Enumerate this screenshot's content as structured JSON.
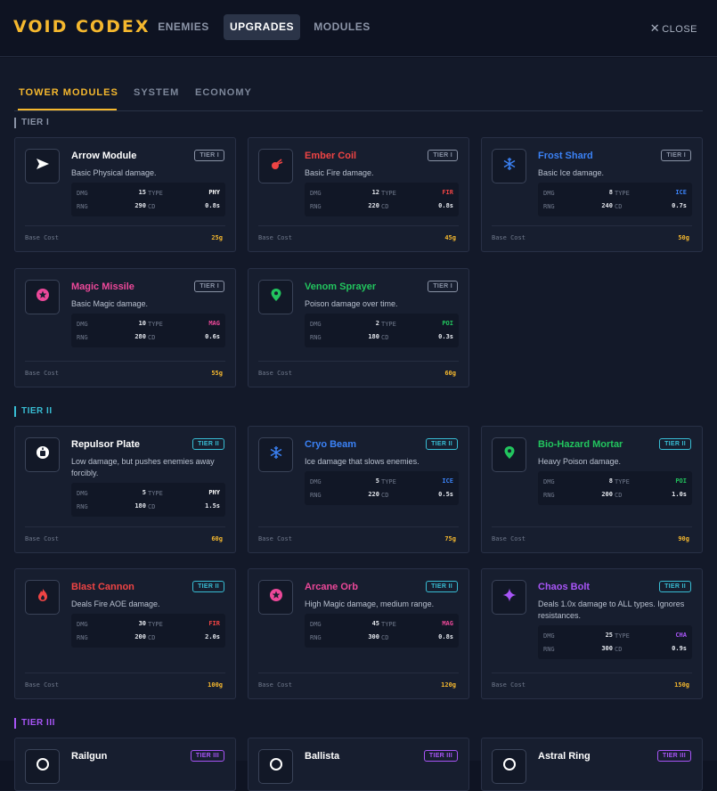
{
  "app": {
    "title": "VOID CODEX",
    "close_label": "CLOSE"
  },
  "nav": {
    "tabs": [
      {
        "label": "ENEMIES"
      },
      {
        "label": "UPGRADES"
      },
      {
        "label": "MODULES"
      }
    ],
    "active": "UPGRADES"
  },
  "subtabs": [
    {
      "label": "TOWER MODULES"
    },
    {
      "label": "SYSTEM"
    },
    {
      "label": "ECONOMY"
    }
  ],
  "labels": {
    "dmg": "DMG",
    "rng": "RNG",
    "type": "TYPE",
    "cd": "CD",
    "base_cost": "Base Cost"
  },
  "colors": {
    "accent": "#f5b82e",
    "tier1": "#8a93a6",
    "tier2": "#38bdd4",
    "tier3": "#a855f7",
    "physical": "#ffffff",
    "fire": "#ef4444",
    "ice": "#3b82f6",
    "magic": "#ec4899",
    "poison": "#22c55e",
    "chaos": "#a855f7"
  },
  "tiers": [
    {
      "label": "TIER I",
      "badge": "TIER I",
      "cards": [
        {
          "name": "Arrow Module",
          "description": "Basic Physical damage.",
          "dmg": "15",
          "type": "PHY",
          "rng": "290",
          "cd": "0.8s",
          "cost": "25g",
          "icon": "arrow-icon"
        },
        {
          "name": "Ember Coil",
          "description": "Basic Fire damage.",
          "dmg": "12",
          "type": "FIR",
          "rng": "220",
          "cd": "0.8s",
          "cost": "45g",
          "icon": "ember-icon"
        },
        {
          "name": "Frost Shard",
          "description": "Basic Ice damage.",
          "dmg": "8",
          "type": "ICE",
          "rng": "240",
          "cd": "0.7s",
          "cost": "50g",
          "icon": "snowflake-icon"
        },
        {
          "name": "Magic Missile",
          "description": "Basic Magic damage.",
          "dmg": "10",
          "type": "MAG",
          "rng": "280",
          "cd": "0.6s",
          "cost": "55g",
          "icon": "star-orb-icon"
        },
        {
          "name": "Venom Sprayer",
          "description": "Poison damage over time.",
          "dmg": "2",
          "type": "POI",
          "rng": "180",
          "cd": "0.3s",
          "cost": "60g",
          "icon": "poison-pin-icon"
        }
      ]
    },
    {
      "label": "TIER II",
      "badge": "TIER II",
      "cards": [
        {
          "name": "Repulsor Plate",
          "description": "Low damage, but pushes enemies away forcibly.",
          "dmg": "5",
          "type": "PHY",
          "rng": "180",
          "cd": "1.5s",
          "cost": "60g",
          "icon": "repulsor-icon"
        },
        {
          "name": "Cryo Beam",
          "description": "Ice damage that slows enemies.",
          "dmg": "5",
          "type": "ICE",
          "rng": "220",
          "cd": "0.5s",
          "cost": "75g",
          "icon": "snowflake-icon"
        },
        {
          "name": "Bio-Hazard Mortar",
          "description": "Heavy Poison damage.",
          "dmg": "8",
          "type": "POI",
          "rng": "200",
          "cd": "1.0s",
          "cost": "90g",
          "icon": "poison-pin-icon"
        },
        {
          "name": "Blast Cannon",
          "description": "Deals Fire AOE damage.",
          "dmg": "30",
          "type": "FIR",
          "rng": "200",
          "cd": "2.0s",
          "cost": "100g",
          "icon": "flame-icon"
        },
        {
          "name": "Arcane Orb",
          "description": "High Magic damage, medium range.",
          "dmg": "45",
          "type": "MAG",
          "rng": "300",
          "cd": "0.8s",
          "cost": "120g",
          "icon": "star-orb-icon"
        },
        {
          "name": "Chaos Bolt",
          "description": "Deals 1.0x damage to ALL types. Ignores resistances.",
          "dmg": "25",
          "type": "CHA",
          "rng": "300",
          "cd": "0.9s",
          "cost": "150g",
          "icon": "sparkle-icon"
        }
      ]
    },
    {
      "label": "TIER III",
      "badge": "TIER III",
      "cards": [
        {
          "name": "Railgun",
          "icon": "railgun-icon"
        },
        {
          "name": "Ballista",
          "icon": "ballista-icon"
        },
        {
          "name": "Astral Ring",
          "icon": "ring-icon"
        }
      ]
    }
  ]
}
